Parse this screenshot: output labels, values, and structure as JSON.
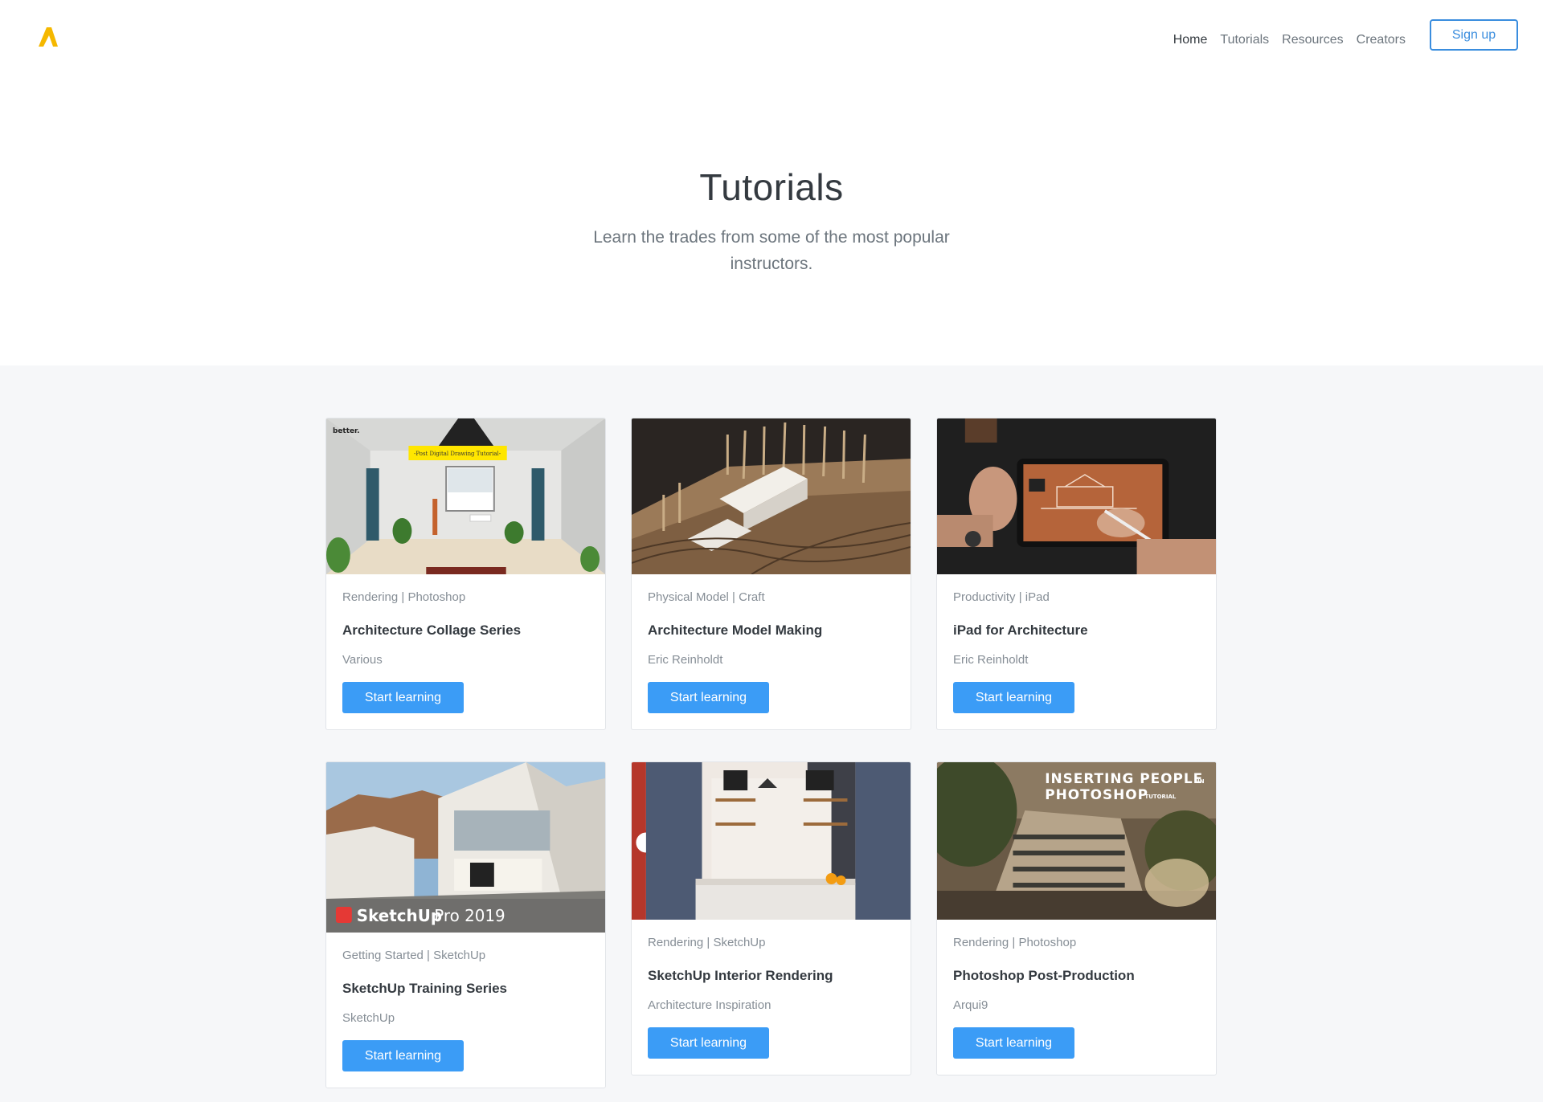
{
  "nav": {
    "logo": "a-logo-icon",
    "links": [
      "Home",
      "Tutorials",
      "Resources",
      "Creators"
    ],
    "signup_label": "Sign up"
  },
  "hero": {
    "title": "Tutorials",
    "subtitle": "Learn the trades from some of the most popular instructors."
  },
  "cards": [
    {
      "tags": "Rendering | Photoshop",
      "title": "Architecture Collage Series",
      "author": "Various",
      "button": "Start learning",
      "thumb_text": [
        "better.",
        "-Post Digital Drawing Tutorial-"
      ]
    },
    {
      "tags": "Physical Model | Craft",
      "title": "Architecture Model Making",
      "author": "Eric Reinholdt",
      "button": "Start learning"
    },
    {
      "tags": "Productivity | iPad",
      "title": "iPad for Architecture",
      "author": "Eric Reinholdt",
      "button": "Start learning"
    },
    {
      "tags": "Getting Started | SketchUp",
      "title": "SketchUp Training Series",
      "author": "SketchUp",
      "button": "Start learning",
      "thumb_text": [
        "SketchUp",
        "Pro 2019"
      ]
    },
    {
      "tags": "Rendering | SketchUp",
      "title": "SketchUp Interior Rendering",
      "author": "Architecture Inspiration",
      "button": "Start learning"
    },
    {
      "tags": "Rendering | Photoshop",
      "title": "Photoshop Post-Production",
      "author": "Arqui9",
      "button": "Start learning",
      "thumb_text": [
        "INSERTING PEOPLE",
        "IN",
        "PHOTOSHOP",
        "TUTORIAL"
      ]
    }
  ],
  "colors": {
    "accent": "#3b9cf6",
    "logo": "#f5b800",
    "section_bg": "#f6f7f9"
  }
}
